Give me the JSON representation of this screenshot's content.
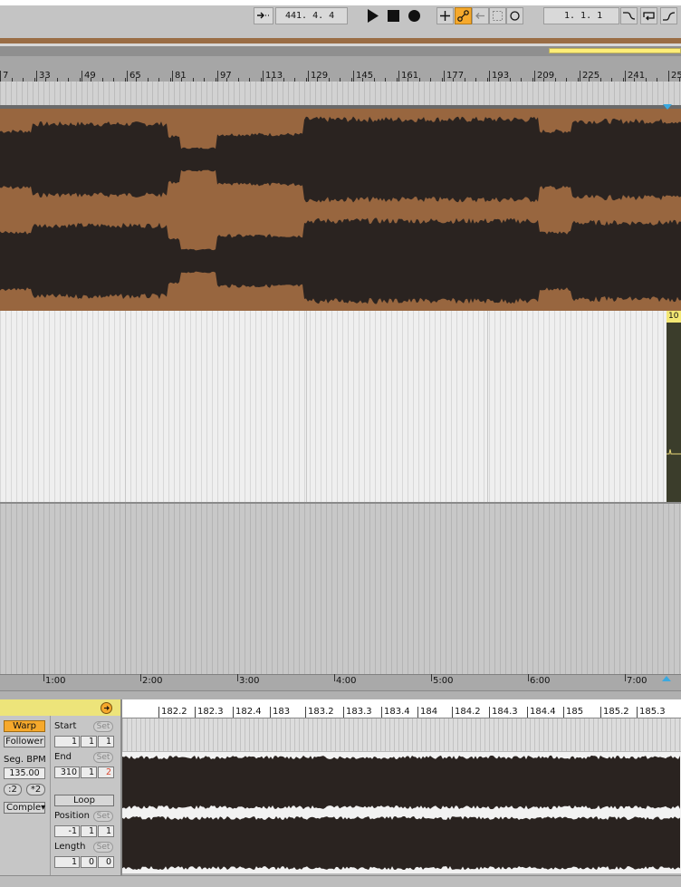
{
  "transport": {
    "tempo_display": "441.  4.  4",
    "position_display": "1.  1.  1"
  },
  "ruler": {
    "marks": [
      "7",
      "33",
      "49",
      "65",
      "81",
      "97",
      "113",
      "129",
      "145",
      "161",
      "177",
      "193",
      "209",
      "225",
      "241",
      "25"
    ]
  },
  "track": {
    "clip_label": "10"
  },
  "timeline": {
    "marks": [
      "1:00",
      "2:00",
      "3:00",
      "4:00",
      "5:00",
      "6:00",
      "7:00"
    ]
  },
  "clip_view": {
    "warp_label": "Warp",
    "warp_mode": "Follower",
    "seg_bpm_label": "Seg. BPM",
    "seg_bpm_value": "135.00",
    "halve_label": ":2",
    "double_label": "*2",
    "warp_algo": "Comple▾",
    "start_label": "Start",
    "start_values": [
      "1",
      "1",
      "1"
    ],
    "end_label": "End",
    "end_values": [
      "310",
      "1",
      "2"
    ],
    "set_label": "Set",
    "loop_label": "Loop",
    "position_label": "Position",
    "position_values": [
      "-1",
      "1",
      "1"
    ],
    "length_label": "Length",
    "length_values": [
      "1",
      "0",
      "0"
    ],
    "ruler_marks": [
      "182.2",
      "182.3",
      "182.4",
      "183",
      "183.2",
      "183.3",
      "183.4",
      "184",
      "184.2",
      "184.3",
      "184.4",
      "185",
      "185.2",
      "185.3"
    ]
  },
  "colors": {
    "accent": "#f6a92c",
    "clip_header": "#ede47a",
    "waveform_bg": "#98663f",
    "waveform": "#2a2320",
    "loop_bar": "#ffee77"
  }
}
